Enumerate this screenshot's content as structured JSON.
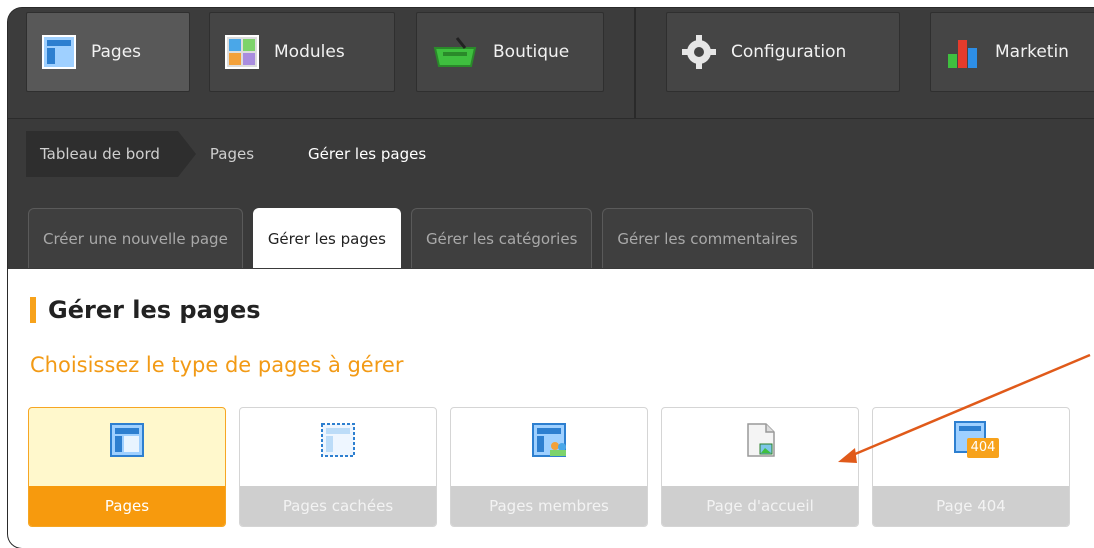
{
  "nav": {
    "items": [
      {
        "label": "Pages",
        "icon": "pages-icon"
      },
      {
        "label": "Modules",
        "icon": "modules-icon"
      },
      {
        "label": "Boutique",
        "icon": "basket-icon"
      },
      {
        "label": "Configuration",
        "icon": "gear-icon"
      },
      {
        "label": "Marketin",
        "icon": "bar-chart-icon"
      }
    ]
  },
  "breadcrumb": {
    "items": [
      "Tableau de bord",
      "Pages",
      "Gérer les pages"
    ]
  },
  "tabs": [
    "Créer une nouvelle page",
    "Gérer les pages",
    "Gérer les catégories",
    "Gérer les commentaires"
  ],
  "main": {
    "title": "Gérer les pages",
    "subtitle": "Choisissez le type de pages à gérer",
    "cards": [
      {
        "label": "Pages",
        "icon": "page-layout-icon"
      },
      {
        "label": "Pages cachées",
        "icon": "hidden-page-icon"
      },
      {
        "label": "Pages membres",
        "icon": "members-page-icon"
      },
      {
        "label": "Page d'accueil",
        "icon": "home-page-icon"
      },
      {
        "label": "Page 404",
        "icon": "page-404-icon",
        "badge": "404"
      }
    ]
  },
  "colors": {
    "accent": "#f7a21b",
    "active_card": "#fff8cc",
    "active_label": "#f79a0d",
    "arrow": "#e05a1a"
  }
}
